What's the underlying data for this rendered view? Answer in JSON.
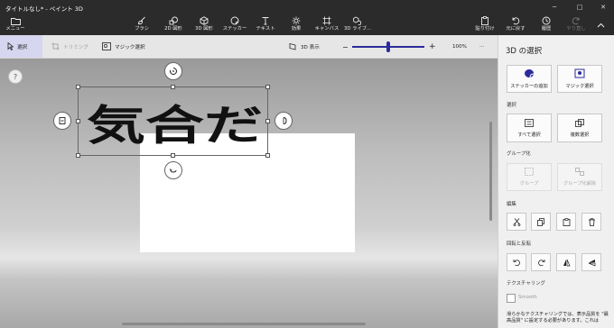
{
  "window": {
    "title": "タイトルなし* - ペイント 3D",
    "controls": {
      "minimize": "─",
      "maximize": "□",
      "close": "✕"
    }
  },
  "ribbon": {
    "menu_label": "メニュー",
    "tools": [
      {
        "label": "ブラシ",
        "icon": "brush-icon"
      },
      {
        "label": "2D 図形",
        "icon": "2d-shapes-icon"
      },
      {
        "label": "3D 図形",
        "icon": "3d-shapes-icon"
      },
      {
        "label": "ステッカー",
        "icon": "sticker-icon"
      },
      {
        "label": "テキスト",
        "icon": "text-icon"
      },
      {
        "label": "効果",
        "icon": "effects-icon"
      },
      {
        "label": "キャンバス",
        "icon": "canvas-icon"
      },
      {
        "label": "3D ライブ...",
        "icon": "3d-library-icon"
      }
    ],
    "actions": [
      {
        "label": "貼り付け",
        "icon": "paste-icon"
      },
      {
        "label": "元に戻す",
        "icon": "undo-icon"
      },
      {
        "label": "履歴",
        "icon": "history-icon"
      },
      {
        "label": "やり直し",
        "icon": "redo-icon"
      }
    ]
  },
  "toolbar": {
    "select_label": "選択",
    "trim_label": "トリミング",
    "magic_select_label": "マジック選択",
    "view3d_label": "3D 表示",
    "zoom_minus": "−",
    "zoom_plus": "+",
    "zoom_value": "100%",
    "zoom_level": 0.5,
    "more": "···"
  },
  "canvas": {
    "help": "?",
    "sticker_text": "気合だ"
  },
  "panel": {
    "title": "3D の選択",
    "top_buttons": {
      "add_sticker": "ステッカーの追加",
      "magic_select": "マジック選択"
    },
    "select_section": "選択",
    "select_all": "すべて選択",
    "multi_select": "複数選択",
    "group_section": "グループ化",
    "group": "グループ",
    "ungroup": "グループ化解除",
    "edit_section": "編集",
    "rotate_section": "回転と反転",
    "texture_section": "テクスチャリング",
    "smooth": "Smooth",
    "note": "滑らかなテクスチャリングでは、表示品質を \"最高品質\" に設定する必要があります。これは"
  },
  "colors": {
    "accent": "#2b2b9b",
    "ribbon_bg": "#2b2b2b",
    "panel_bg": "#f0f0f0"
  }
}
